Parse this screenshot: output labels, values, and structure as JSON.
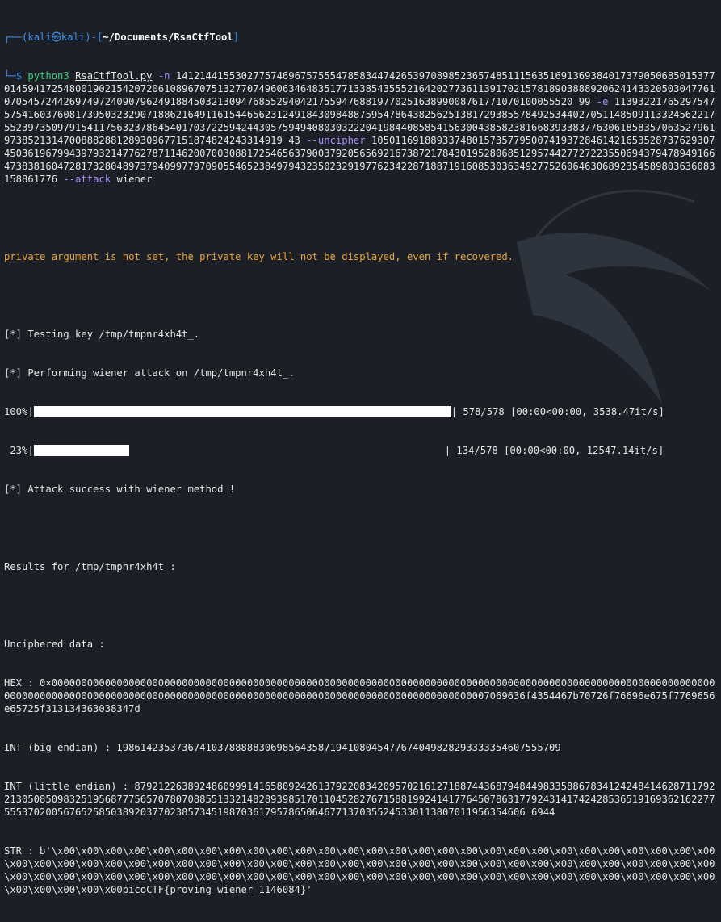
{
  "prompt": {
    "user": "kali",
    "host": "kali",
    "path": "~/Documents/RsaCtfTool",
    "dollar": "$"
  },
  "command": {
    "program": "python3",
    "script": "RsaCtfTool.py",
    "flag_n": "-n",
    "n_value": "1412144155302775746967575554785834474265397089852365748511156351691369384017379050685015377014594172548001902154207206108967075132770749606346483517713385435552164202773611391702157818903888920624143320503047761070545724426974972409079624918845032130947685529404217559476881977025163899008761771070100055520 99",
    "flag_e": "-e",
    "e_value": "1139322176529754757541603760817395032329071886216491161544656231249184309848875954786438256251381729385578492534402705114850911332456221755239735097915411756323786454017037225942443057594940803032220419844085854156300438582381668393383776306185835706352796197385213147008882881289309677151874824243314919 43",
    "flag_uncipher": "--uncipher",
    "uncipher_value": "1050116918893374801573577950074193728461421653528737629307450361967994397932147762787114620070030881725465637900379205656921673872178430195280685129574427727223550694379478949166473838160472817328048973794099779709055465238497943235023291977623422871887191608530363492775260646306892354589803636083158861776",
    "flag_attack": "--attack",
    "attack_value": "wiener"
  },
  "output": {
    "warning": "private argument is not set, the private key will not be displayed, even if recovered.",
    "testing": "[*] Testing key /tmp/tmpnr4xh4t_.",
    "performing": "[*] Performing wiener attack on /tmp/tmpnr4xh4t_.",
    "progress1": {
      "percent": "100%",
      "fraction": 1.0,
      "stats": "| 578/578 [00:00<00:00, 3538.47it/s]"
    },
    "progress2": {
      "percent": " 23%",
      "fraction": 0.23,
      "stats": "| 134/578 [00:00<00:00, 12547.14it/s]"
    },
    "success": "[*] Attack success with wiener method !",
    "results_for": "Results for /tmp/tmpnr4xh4t_:",
    "unciphered_label": "Unciphered data :",
    "hex": "HEX : 0×00000000000000000000000000000000000000000000000000000000000000000000000000000000000000000000000000000000000000000000000000000000000000000000000000000000000000000000000000000000000000000000000007069636f4354467b70726f76696e675f7769656e65725f313134363038347d",
    "int_big": "INT (big endian) : 198614235373674103788888306985643587194108045477674049828293333354607555709",
    "int_little": "INT (little endian) : 879212263892486099914165809242613792208342095702161271887443687948449833588678341242484146287117922130508509832519568777565707807088551332148289398517011045282767158819924141776450786317792431417424285365191693621622775553702005676525850389203770238573451987036179578650646771370355245330113807011956354606 6944",
    "str": "STR : b'\\x00\\x00\\x00\\x00\\x00\\x00\\x00\\x00\\x00\\x00\\x00\\x00\\x00\\x00\\x00\\x00\\x00\\x00\\x00\\x00\\x00\\x00\\x00\\x00\\x00\\x00\\x00\\x00\\x00\\x00\\x00\\x00\\x00\\x00\\x00\\x00\\x00\\x00\\x00\\x00\\x00\\x00\\x00\\x00\\x00\\x00\\x00\\x00\\x00\\x00\\x00\\x00\\x00\\x00\\x00\\x00\\x00\\x00\\x00\\x00\\x00\\x00\\x00\\x00\\x00\\x00\\x00\\x00\\x00\\x00\\x00\\x00\\x00\\x00\\x00\\x00\\x00\\x00\\x00\\x00\\x00\\x00\\x00\\x00\\x00\\x00\\x00\\x00\\x00\\x00\\x00\\x00\\x00picoCTF{proving_wiener_1146084}'"
  }
}
